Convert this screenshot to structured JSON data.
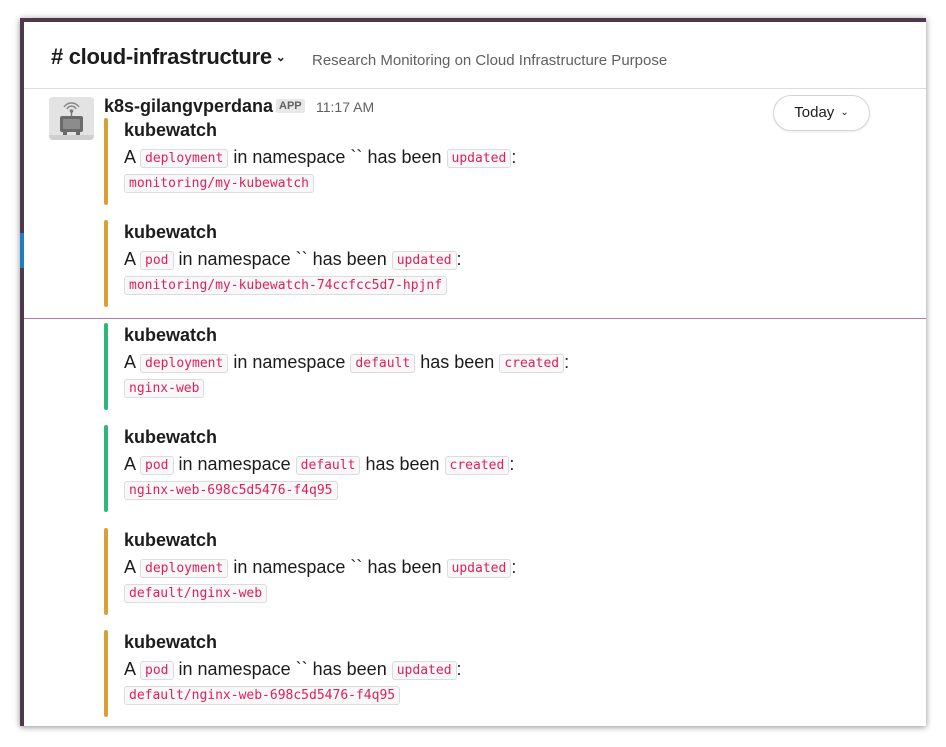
{
  "channel": {
    "name": "# cloud-infrastructure",
    "description": "Research Monitoring on Cloud Infrastructure Purpose"
  },
  "message": {
    "sender": "k8s-gilangvperdana",
    "badge": "APP",
    "time": "11:17 AM"
  },
  "date_button": {
    "label": "Today"
  },
  "colors": {
    "sidebar": "#4d394b",
    "updated_bar": "#daa038",
    "created_bar": "#2eb67d",
    "code_text": "#e01e5a"
  },
  "attachments": [
    {
      "title": "kubewatch",
      "prefix": "A",
      "kind": "deployment",
      "mid": "in namespace",
      "namespace": "``",
      "ns_is_code": false,
      "verb_text": "has been",
      "action": "updated",
      "suffix": ":",
      "name": "monitoring/my-kubewatch",
      "color": "#daa038"
    },
    {
      "title": "kubewatch",
      "prefix": "A",
      "kind": "pod",
      "mid": "in namespace",
      "namespace": "``",
      "ns_is_code": false,
      "verb_text": "has been",
      "action": "updated",
      "suffix": ":",
      "name": "monitoring/my-kubewatch-74ccfcc5d7-hpjnf",
      "color": "#daa038"
    },
    {
      "title": "kubewatch",
      "prefix": "A",
      "kind": "deployment",
      "mid": "in namespace",
      "namespace": "default",
      "ns_is_code": true,
      "verb_text": "has been",
      "action": "created",
      "suffix": ":",
      "name": "nginx-web",
      "color": "#2eb67d"
    },
    {
      "title": "kubewatch",
      "prefix": "A",
      "kind": "pod",
      "mid": "in namespace",
      "namespace": "default",
      "ns_is_code": true,
      "verb_text": "has been",
      "action": "created",
      "suffix": ":",
      "name": "nginx-web-698c5d5476-f4q95",
      "color": "#2eb67d"
    },
    {
      "title": "kubewatch",
      "prefix": "A",
      "kind": "deployment",
      "mid": "in namespace",
      "namespace": "``",
      "ns_is_code": false,
      "verb_text": "has been",
      "action": "updated",
      "suffix": ":",
      "name": "default/nginx-web",
      "color": "#daa038"
    },
    {
      "title": "kubewatch",
      "prefix": "A",
      "kind": "pod",
      "mid": "in namespace",
      "namespace": "``",
      "ns_is_code": false,
      "verb_text": "has been",
      "action": "updated",
      "suffix": ":",
      "name": "default/nginx-web-698c5d5476-f4q95",
      "color": "#daa038"
    }
  ]
}
